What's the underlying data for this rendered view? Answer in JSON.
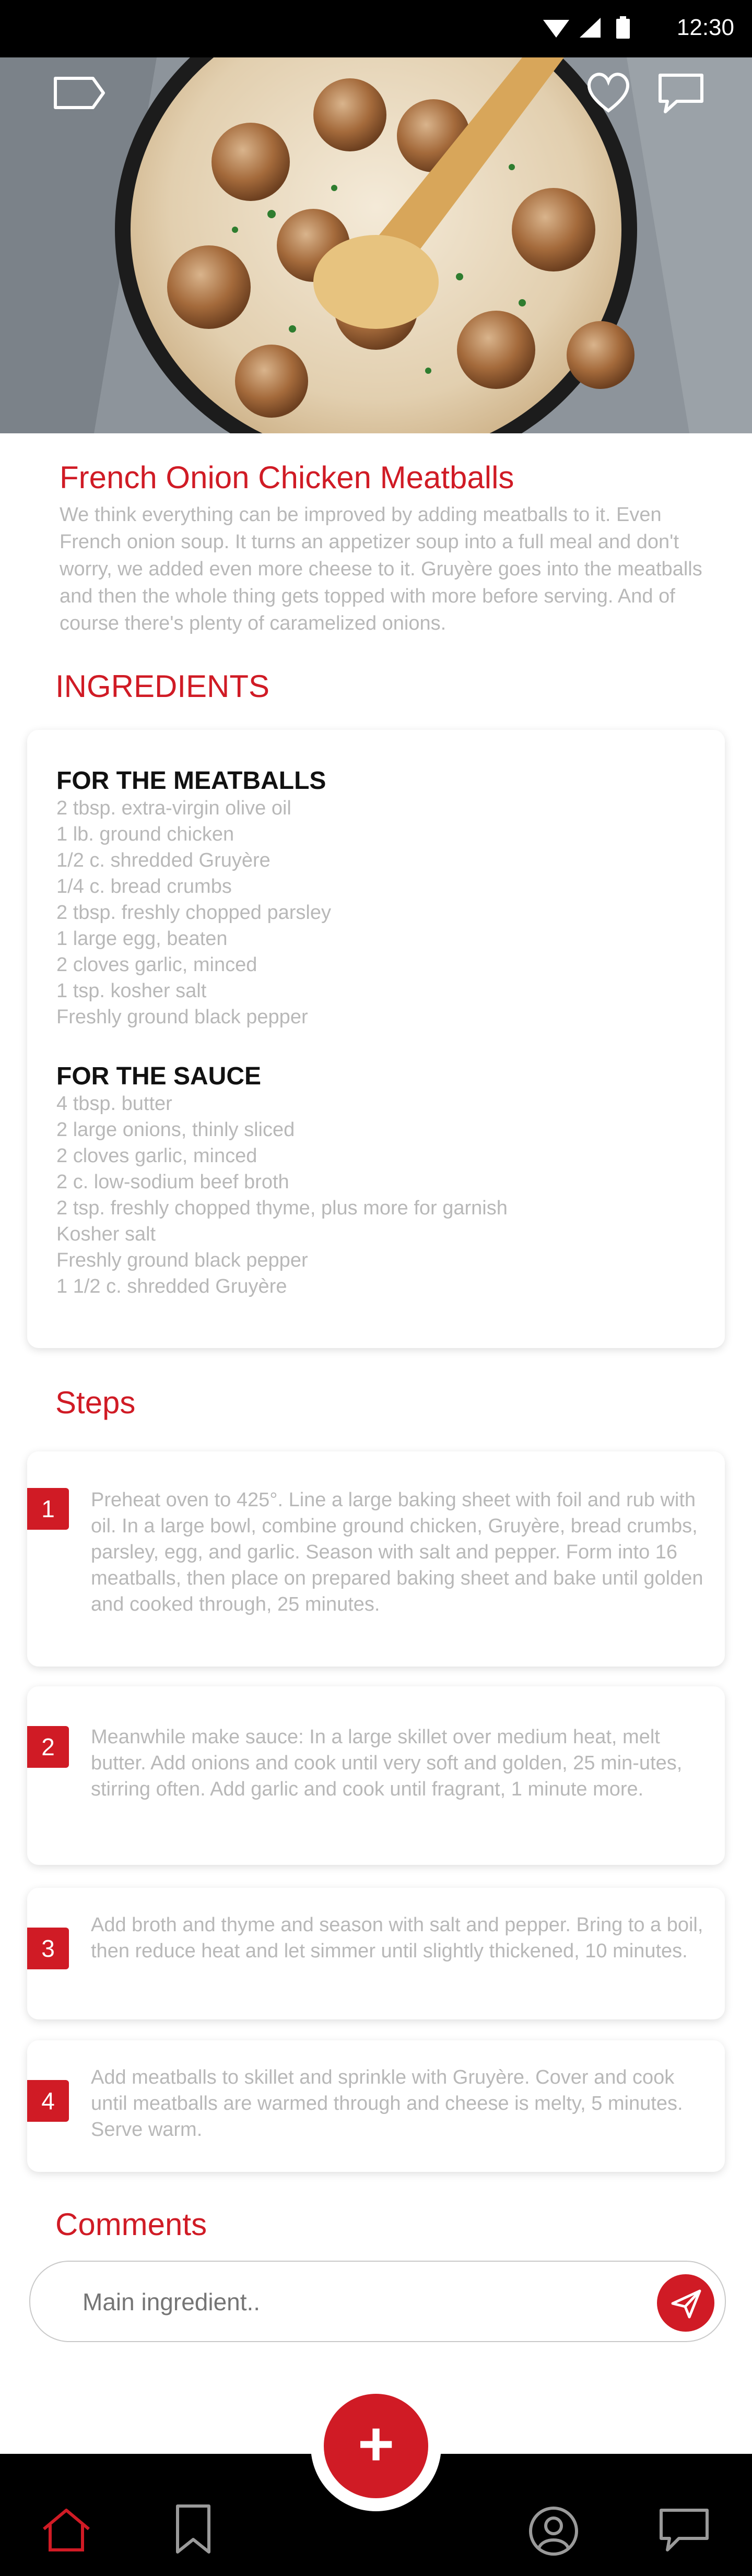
{
  "status_bar": {
    "time": "12:30"
  },
  "hero": {
    "icons": [
      "tag-icon",
      "heart-icon",
      "chat-icon"
    ]
  },
  "recipe": {
    "title": "French Onion Chicken Meatballs",
    "description": "We think everything can be improved by adding meatballs to it. Even French onion soup. It turns an appetizer soup into a full meal and don't worry, we added even more cheese to it. Gruyère goes into the meatballs and then the whole thing gets topped with more before serving. And of course there's plenty of caramelized onions."
  },
  "ingredients": {
    "heading": "INGREDIENTS",
    "groups": [
      {
        "title": "FOR THE MEATBALLS",
        "items": [
          "2 tbsp. extra-virgin olive oil",
          "1 lb. ground chicken",
          "1/2 c. shredded Gruyère",
          "1/4 c. bread crumbs",
          "2 tbsp. freshly chopped parsley",
          "1 large egg, beaten",
          "2 cloves garlic, minced",
          "1 tsp. kosher salt",
          "Freshly ground black pepper"
        ]
      },
      {
        "title": "FOR THE SAUCE",
        "items": [
          "4 tbsp. butter",
          "2 large onions, thinly sliced",
          "2 cloves garlic, minced",
          "2 c. low-sodium beef broth",
          "2 tsp. freshly chopped thyme, plus more for garnish",
          "Kosher salt",
          "Freshly ground black pepper",
          "1 1/2 c. shredded Gruyère"
        ]
      }
    ]
  },
  "steps": {
    "heading": "Steps",
    "items": [
      {
        "number": "1",
        "text": "Preheat oven to 425°. Line a large baking sheet with foil and rub with oil. In a large bowl, combine ground chicken, Gruyère, bread crumbs, parsley, egg, and garlic. Season with salt and pepper. Form into 16 meatballs, then place on prepared baking sheet and bake until golden and cooked through, 25 minutes."
      },
      {
        "number": "2",
        "text": "Meanwhile make sauce: In a large skillet over medium heat, melt butter. Add onions and cook until very soft and golden, 25 min-utes, stirring often. Add garlic and cook until fragrant, 1 minute more."
      },
      {
        "number": "3",
        "text": "Add broth and thyme and season with salt and pepper. Bring to a boil, then reduce heat and let simmer until slightly thickened, 10 minutes."
      },
      {
        "number": "4",
        "text": "Add meatballs to skillet and sprinkle with Gruyère. Cover and cook until meatballs are warmed through and cheese is melty, 5 minutes. Serve warm."
      }
    ]
  },
  "comments": {
    "heading": "Comments",
    "placeholder": "Main ingredient.."
  },
  "fab": {
    "label": "+"
  },
  "bottom_nav": {
    "icons": [
      "home-icon",
      "bookmark-icon",
      "profile-icon",
      "messages-icon"
    ],
    "active": "home-icon"
  },
  "colors": {
    "accent": "#d01b25",
    "muted_text": "#b8b8b8",
    "bar": "#000000"
  }
}
